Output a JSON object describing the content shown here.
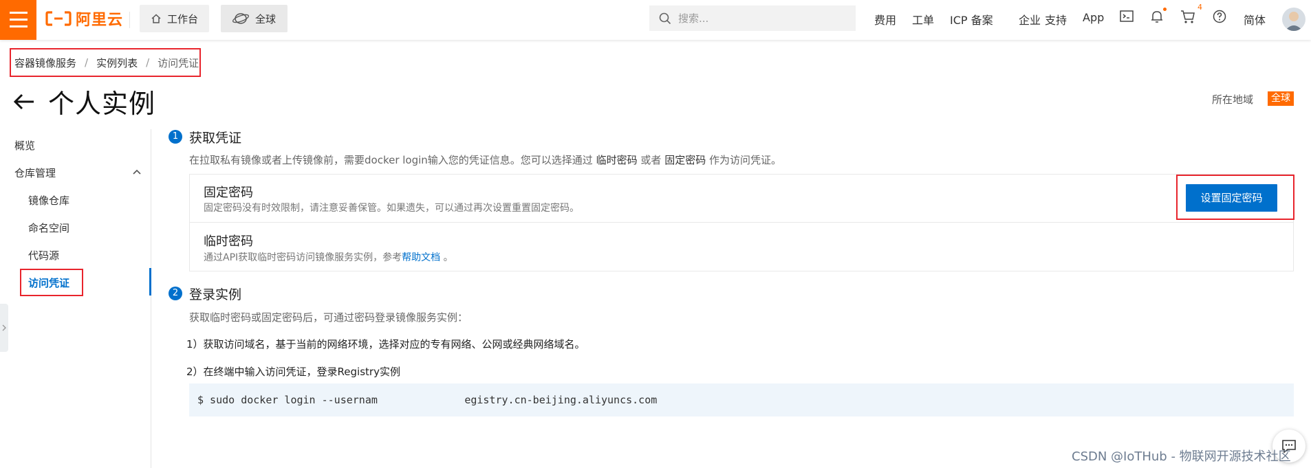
{
  "brand": {
    "name": "阿里云",
    "color": "#ff6a00"
  },
  "topbar": {
    "tabs": [
      {
        "label": "工作台",
        "icon": "home-icon"
      },
      {
        "label": "全球",
        "icon": "globe-icon"
      }
    ],
    "search_placeholder": "搜索...",
    "links": [
      "费用",
      "工单",
      "ICP 备案",
      "企业",
      "支持",
      "App"
    ],
    "cart_count": "4",
    "lang": "简体"
  },
  "breadcrumb": {
    "items": [
      "容器镜像服务",
      "实例列表",
      "访问凭证"
    ]
  },
  "page": {
    "title": "个人实例",
    "region_label": "所在地域",
    "region_value": "全球"
  },
  "sidebar": {
    "items": [
      "概览",
      "仓库管理",
      "镜像仓库",
      "命名空间",
      "代码源",
      "访问凭证"
    ]
  },
  "step1": {
    "num": "1",
    "title": "获取凭证",
    "desc_prefix": "在拉取私有镜像或者上传镜像前，需要docker login输入您的凭证信息。您可以选择通过",
    "desc_a": "临时密码",
    "desc_mid": "或者",
    "desc_b": "固定密码",
    "desc_suffix": "作为访问凭证。",
    "fixed": {
      "title": "固定密码",
      "sub": "固定密码没有时效限制，请注意妥善保管。如果遗失，可以通过再次设置重置固定密码。",
      "button": "设置固定密码"
    },
    "temp": {
      "title": "临时密码",
      "sub_prefix": "通过API获取临时密码访问镜像服务实例，参考",
      "sub_link": "帮助文档",
      "sub_suffix": "。"
    }
  },
  "step2": {
    "num": "2",
    "title": "登录实例",
    "desc": "获取临时密码或固定密码后，可通过密码登录镜像服务实例：",
    "line1": "1）获取访问域名，基于当前的网络环境，选择对应的专有网络、公网或经典网络域名。",
    "line2": "2）在终端中输入访问凭证，登录Registry实例",
    "code": "$ sudo docker login --usernam              egistry.cn-beijing.aliyuncs.com"
  },
  "watermark": "CSDN @IoTHub - 物联网开源技术社区"
}
